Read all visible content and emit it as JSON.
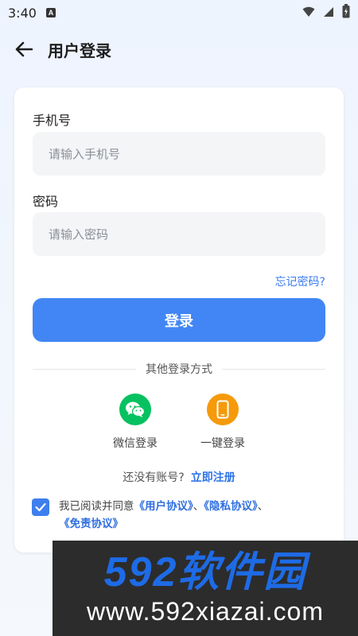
{
  "status_bar": {
    "time": "3:40",
    "notification_icon": "A"
  },
  "header": {
    "back_icon": "arrow-left-icon",
    "title": "用户登录"
  },
  "form": {
    "phone_label": "手机号",
    "phone_placeholder": "请输入手机号",
    "phone_value": "",
    "password_label": "密码",
    "password_placeholder": "请输入密码",
    "password_value": "",
    "forgot_label": "忘记密码?",
    "login_label": "登录"
  },
  "other_login": {
    "divider_text": "其他登录方式",
    "wechat_label": "微信登录",
    "onekey_label": "一键登录"
  },
  "register": {
    "question": "还没有账号?",
    "link": "立即注册"
  },
  "agreement": {
    "checked": true,
    "prefix": "我已阅读并同意",
    "user_agreement": "《用户协议》",
    "sep1": "、",
    "privacy_agreement": "《隐私协议》",
    "sep2": "、",
    "disclaimer_agreement": "《免责协议》"
  },
  "watermark": {
    "brand": "592软件园",
    "url": "www.592xiazai.com"
  },
  "colors": {
    "primary": "#4286f5",
    "link": "#2f74e8",
    "wechat_green": "#07c160",
    "onekey_orange": "#f59a0b",
    "input_bg": "#f4f5f7"
  }
}
